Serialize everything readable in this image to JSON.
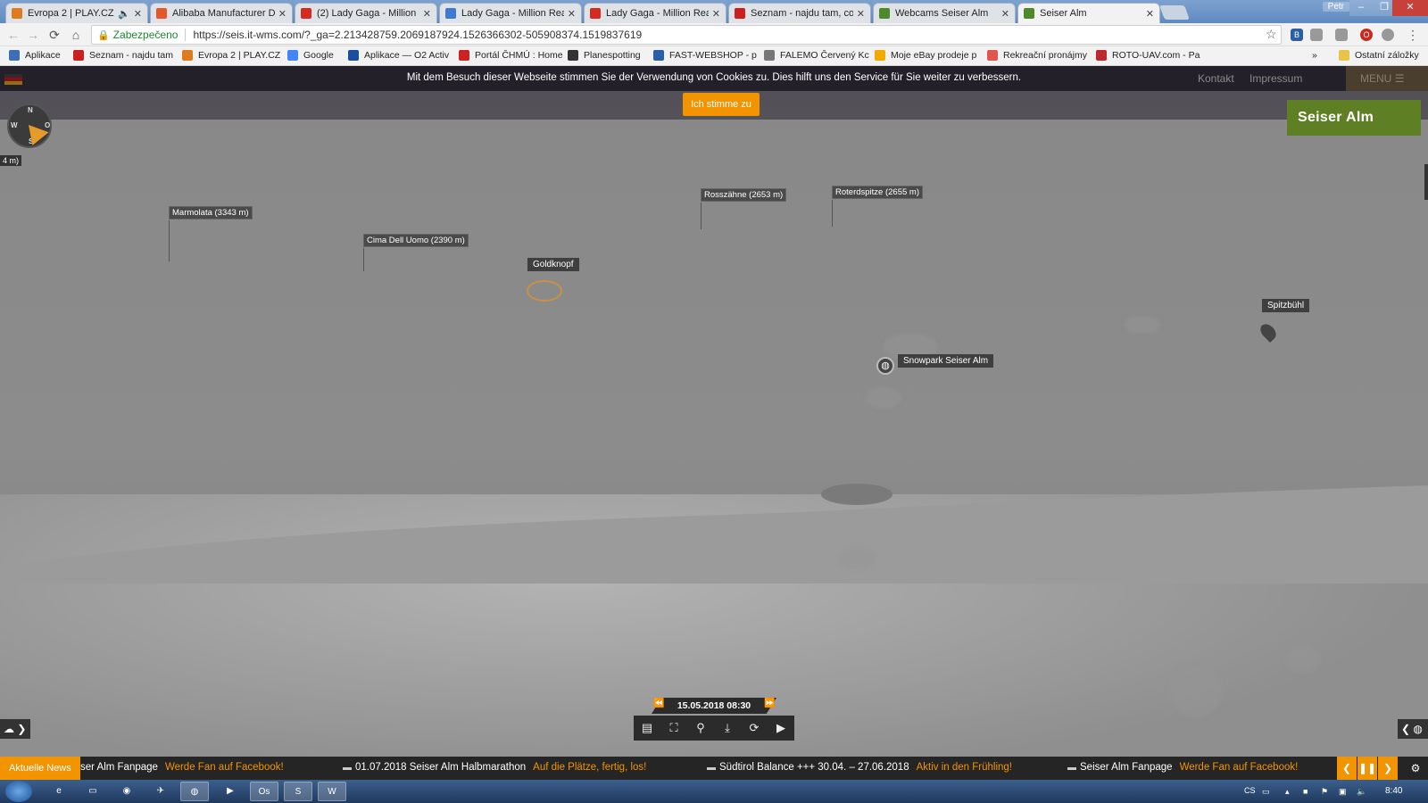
{
  "browser": {
    "tabs": [
      {
        "title": "Evropa 2 | PLAY.CZ",
        "favicon_color": "#e07a1f"
      },
      {
        "title": "Alibaba Manufacturer Di",
        "favicon_color": "#e2582a"
      },
      {
        "title": "(2) Lady Gaga - Million R",
        "favicon_color": "#d62a1f"
      },
      {
        "title": "Lady Gaga - Million Reas",
        "favicon_color": "#3b7bd1"
      },
      {
        "title": "Lady Gaga - Million Reas",
        "favicon_color": "#d62a1f"
      },
      {
        "title": "Seznam - najdu tam, co n",
        "favicon_color": "#cc1f1f"
      },
      {
        "title": "Webcams Seiser Alm",
        "favicon_color": "#4f8a2a"
      },
      {
        "title": "Seiser Alm",
        "favicon_color": "#4f8a2a"
      }
    ],
    "window_user": "Petr",
    "secure_label": "Zabezpečeno",
    "url": "https://seis.it-wms.com/?_ga=2.213428759.2069187924.1526366302-505908374.1519837619",
    "bookmarks": [
      {
        "label": "Aplikace",
        "icon_color": "#3d6fb6"
      },
      {
        "label": "Seznam - najdu tam",
        "icon_color": "#cc1f1f"
      },
      {
        "label": "Evropa 2 | PLAY.CZ",
        "icon_color": "#e07a1f"
      },
      {
        "label": "Google",
        "icon_color": "#4285f4"
      },
      {
        "label": "Aplikace — O2 Activ",
        "icon_color": "#1a4fa0"
      },
      {
        "label": "Portál ČHMÚ : Home",
        "icon_color": "#c22"
      },
      {
        "label": "Planespotting",
        "icon_color": "#333"
      },
      {
        "label": "FAST-WEBSHOP - p",
        "icon_color": "#2a5fa8"
      },
      {
        "label": "FALEMO Červený Kc",
        "icon_color": "#777"
      },
      {
        "label": "Moje eBay prodeje p",
        "icon_color": "#f2a900"
      },
      {
        "label": "Rekreační pronájmy",
        "icon_color": "#e0564f"
      },
      {
        "label": "ROTO-UAV.com - Pa",
        "icon_color": "#c0282f"
      }
    ],
    "more_bookmarks": "»",
    "other_bookmarks": "Ostatní záložky"
  },
  "site": {
    "cookie_text": "Mit dem Besuch dieser Webseite stimmen Sie der Verwendung von Cookies zu. Dies hilft uns den Service für Sie weiter zu verbessern.",
    "accept_label": "Ich stimme zu",
    "nav_kontakt": "Kontakt",
    "nav_impressum": "Impressum",
    "menu_label": "MENU",
    "logo_text": "Seiser Alm",
    "brand_color": "#f29400",
    "compass": {
      "n": "N",
      "w": "W",
      "o": "O",
      "s": "S"
    },
    "altitude_tag": "4 m)"
  },
  "peaks": [
    {
      "label": "Marmolata (3343 m)"
    },
    {
      "label": "Cima Dell Uomo (2390 m)"
    },
    {
      "label": "Rosszähne (2653 m)"
    },
    {
      "label": "Roterdspitze (2655 m)"
    }
  ],
  "pois": {
    "goldknopf": "Goldknopf",
    "spitzbuehl": "Spitzbühl",
    "snowpark": "Snowpark Seiser Alm"
  },
  "player": {
    "datetime": "15.05.2018 08:30",
    "controls": [
      {
        "name": "calendar-icon",
        "glyph": "▤"
      },
      {
        "name": "fullscreen-icon",
        "glyph": "⛶"
      },
      {
        "name": "location-pin-icon",
        "glyph": "⚲"
      },
      {
        "name": "download-icon",
        "glyph": "⤓"
      },
      {
        "name": "refresh-icon",
        "glyph": "⟳"
      },
      {
        "name": "video-camera-icon",
        "glyph": "▶"
      }
    ]
  },
  "ticker": {
    "label": "Aktuelle News",
    "items": [
      {
        "title": "ser Alm Fanpage",
        "link": "Werde Fan auf Facebook!"
      },
      {
        "title": "01.07.2018 Seiser Alm Halbmarathon",
        "link": "Auf die Plätze, fertig, los!"
      },
      {
        "title": "Südtirol Balance +++ 30.04. – 27.06.2018",
        "link": "Aktiv in den Frühling!"
      },
      {
        "title": "Seiser Alm Fanpage",
        "link": "Werde Fan auf Facebook!"
      }
    ]
  },
  "taskbar": {
    "language": "CS",
    "time": "8:40"
  }
}
